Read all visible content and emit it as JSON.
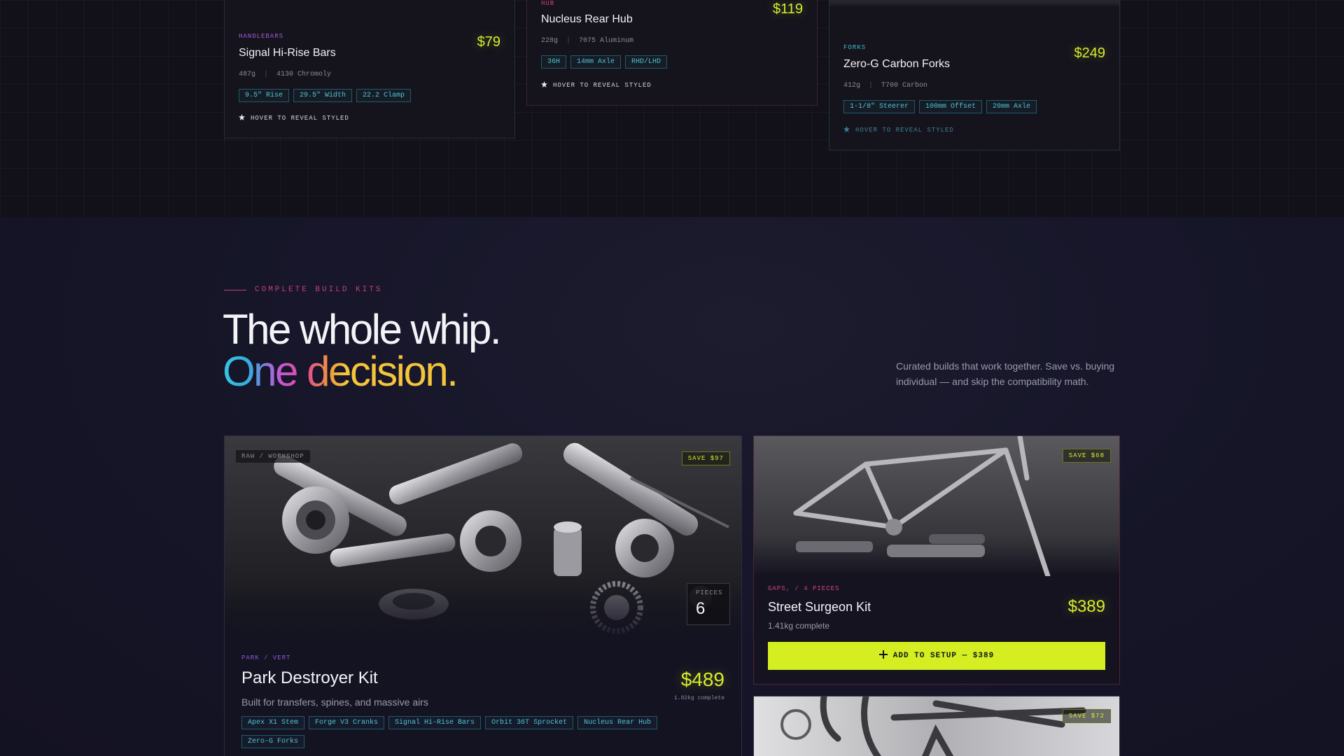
{
  "parts": [
    {
      "category": "HANDLEBARS",
      "category_color": "#a35bd6",
      "name": "Signal Hi-Rise Bars",
      "price": "$79",
      "weight": "487g",
      "material": "4130 Chromoly",
      "tags": [
        "9.5\" Rise",
        "29.5\" Width",
        "22.2 Clamp"
      ],
      "hint": "HOVER TO REVEAL STYLED"
    },
    {
      "category": "HUB",
      "category_color": "#d6437a",
      "name": "Nucleus Rear Hub",
      "price": "$119",
      "weight": "228g",
      "material": "7075 Aluminum",
      "tags": [
        "36H",
        "14mm Axle",
        "RHD/LHD"
      ],
      "hint": "HOVER TO REVEAL STYLED"
    },
    {
      "category": "FORKS",
      "category_color": "#3fb7cf",
      "name": "Zero-G Carbon Forks",
      "price": "$249",
      "weight": "412g",
      "material": "T700 Carbon",
      "tags": [
        "1-1/8\" Steerer",
        "100mm Offset",
        "20mm Axle"
      ],
      "hint": "HOVER TO REVEAL STYLED"
    }
  ],
  "kits_section": {
    "eyebrow": "COMPLETE BUILD KITS",
    "headline_line1": "The whole whip.",
    "headline_line2": "One decision.",
    "description": "Curated builds that work together. Save vs. buying individual — and skip the compatibility math."
  },
  "kits": [
    {
      "raw_badge": "RAW / WORKSHOP",
      "save_badge": "SAVE $97",
      "pieces_label": "PIECES",
      "pieces": "6",
      "category": "PARK / VERT",
      "category_color": "#8a5bd6",
      "name": "Park Destroyer Kit",
      "price": "$489",
      "weight": "1.82kg complete",
      "subtitle": "Built for transfers, spines, and massive airs",
      "tags": [
        "Apex X1 Stem",
        "Forge V3 Cranks",
        "Signal Hi-Rise Bars",
        "Orbit 36T Sprocket",
        "Nucleus Rear Hub",
        "Zero-G Forks"
      ]
    },
    {
      "save_badge": "SAVE $68",
      "category": "GAPS, / 4 PIECES",
      "category_color": "#d6437a",
      "name": "Street Surgeon Kit",
      "price": "$389",
      "weight": "1.41kg complete",
      "button_label": "ADD TO SETUP — $389"
    },
    {
      "save_badge": "SAVE $72"
    }
  ],
  "icons": {
    "hint_icon": "star-icon",
    "button_icon": "plus-icon"
  }
}
